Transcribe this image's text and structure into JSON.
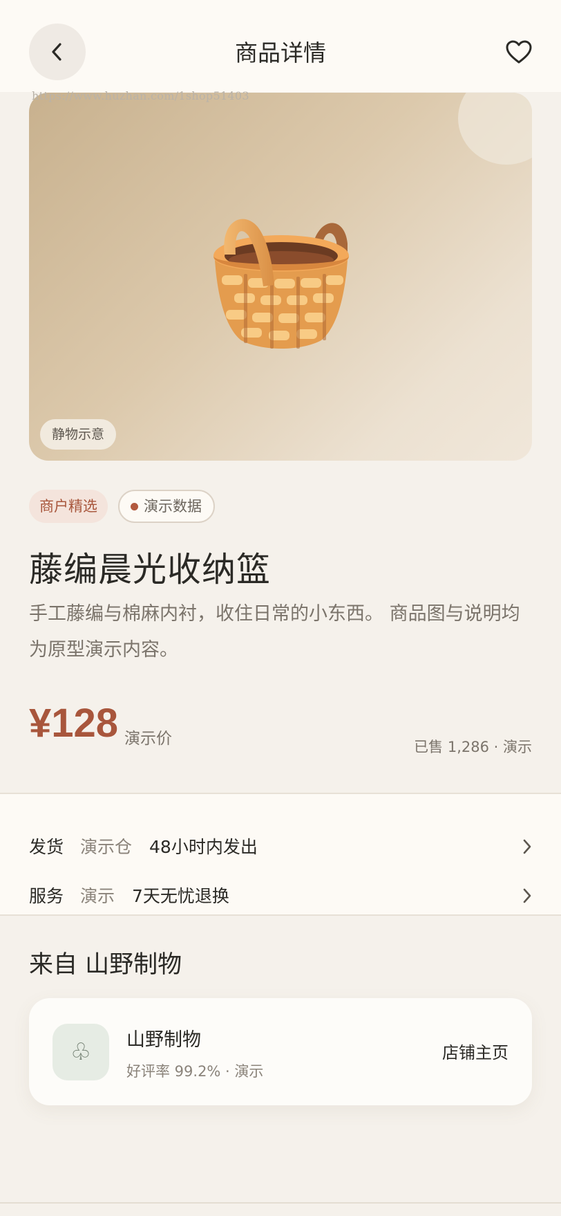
{
  "header": {
    "title": "商品详情",
    "back_icon": "chevron-left-icon",
    "favorite_icon": "heart-outline-icon"
  },
  "watermark": "https://www.huzhan.com/1shop51403",
  "hero": {
    "image_icon": "basket-icon",
    "badge": "静物示意"
  },
  "tags": {
    "merchant": "商户精选",
    "demo": "演示数据"
  },
  "product": {
    "title": "藤编晨光收纳篮",
    "description": "手工藤编与棉麻内衬，收住日常的小东西。 商品图与说明均为原型演示内容。",
    "price": "¥128",
    "price_label": "演示价",
    "sold": "已售 1,286 · 演示"
  },
  "info": {
    "shipping": {
      "key": "发货",
      "meta": "演示仓",
      "value": "48小时内发出"
    },
    "service": {
      "key": "服务",
      "meta": "演示",
      "value": "7天无忧退换"
    }
  },
  "store": {
    "heading": "来自 山野制物",
    "logo_glyph": "♧",
    "name": "山野制物",
    "rating": "好评率 99.2% · 演示",
    "link": "店铺主页"
  },
  "colors": {
    "accent": "#a8563c",
    "background": "#f5f1eb",
    "surface": "#fdfaf5"
  }
}
